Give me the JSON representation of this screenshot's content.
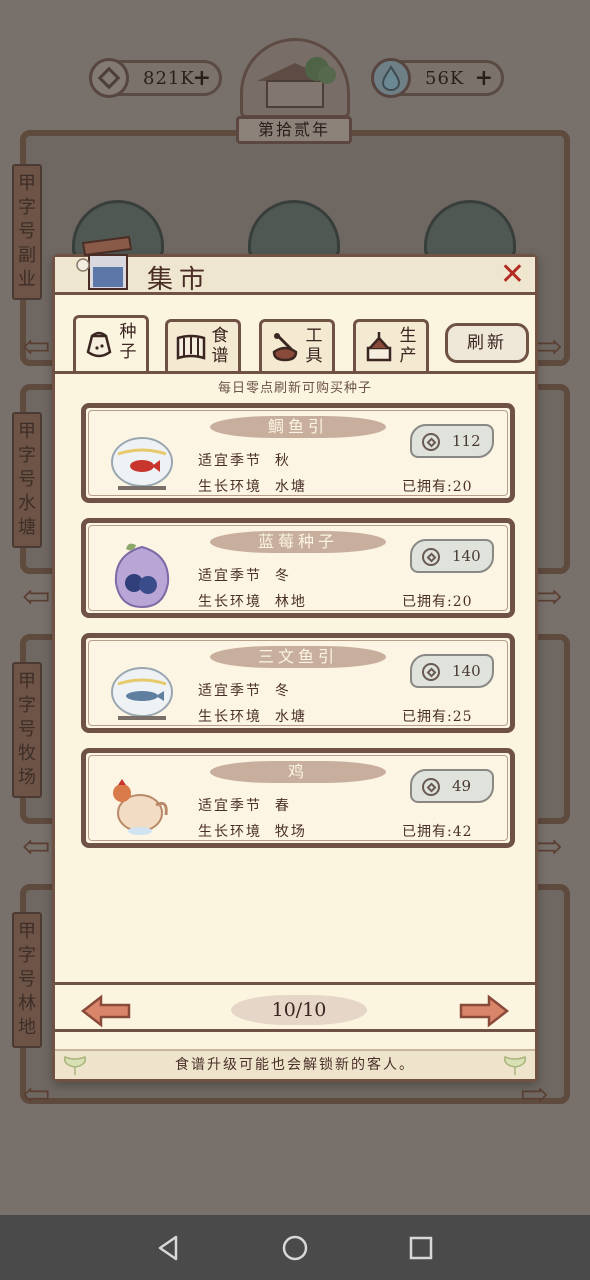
{
  "top_bar": {
    "currency_left": "821K",
    "currency_right": "56K",
    "year": "第拾贰年"
  },
  "background": {
    "side_labels": [
      "甲字号副业",
      "甲字号水塘",
      "甲字号牧场",
      "甲字号林地"
    ]
  },
  "market": {
    "title": "集市",
    "tabs": [
      {
        "label": "种子",
        "icon": "seed-bag-icon",
        "active": true
      },
      {
        "label": "食谱",
        "icon": "recipe-book-icon",
        "active": false
      },
      {
        "label": "工具",
        "icon": "tools-icon",
        "active": false
      },
      {
        "label": "生产",
        "icon": "production-icon",
        "active": false
      }
    ],
    "refresh_label": "刷新",
    "hint": "每日零点刷新可购买种子",
    "items": [
      {
        "name": "鲷鱼引",
        "season_label": "适宜季节",
        "season": "秋",
        "env_label": "生长环境",
        "env": "水塘",
        "owned": "已拥有:20",
        "price": "112",
        "icon": "red-fish-bowl-icon"
      },
      {
        "name": "蓝莓种子",
        "season_label": "适宜季节",
        "season": "冬",
        "env_label": "生长环境",
        "env": "林地",
        "owned": "已拥有:20",
        "price": "140",
        "icon": "blueberry-seed-icon"
      },
      {
        "name": "三文鱼引",
        "season_label": "适宜季节",
        "season": "冬",
        "env_label": "生长环境",
        "env": "水塘",
        "owned": "已拥有:25",
        "price": "140",
        "icon": "salmon-bowl-icon"
      },
      {
        "name": "鸡",
        "season_label": "适宜季节",
        "season": "春",
        "env_label": "生长环境",
        "env": "牧场",
        "owned": "已拥有:42",
        "price": "49",
        "icon": "chicken-icon"
      }
    ],
    "page": "10/10",
    "tip": "食谱升级可能也会解锁新的客人。"
  },
  "colors": {
    "panel_bg": "#fbf4df",
    "border": "#6f5244",
    "close": "#b32a23",
    "arrow": "#c76a4a"
  }
}
